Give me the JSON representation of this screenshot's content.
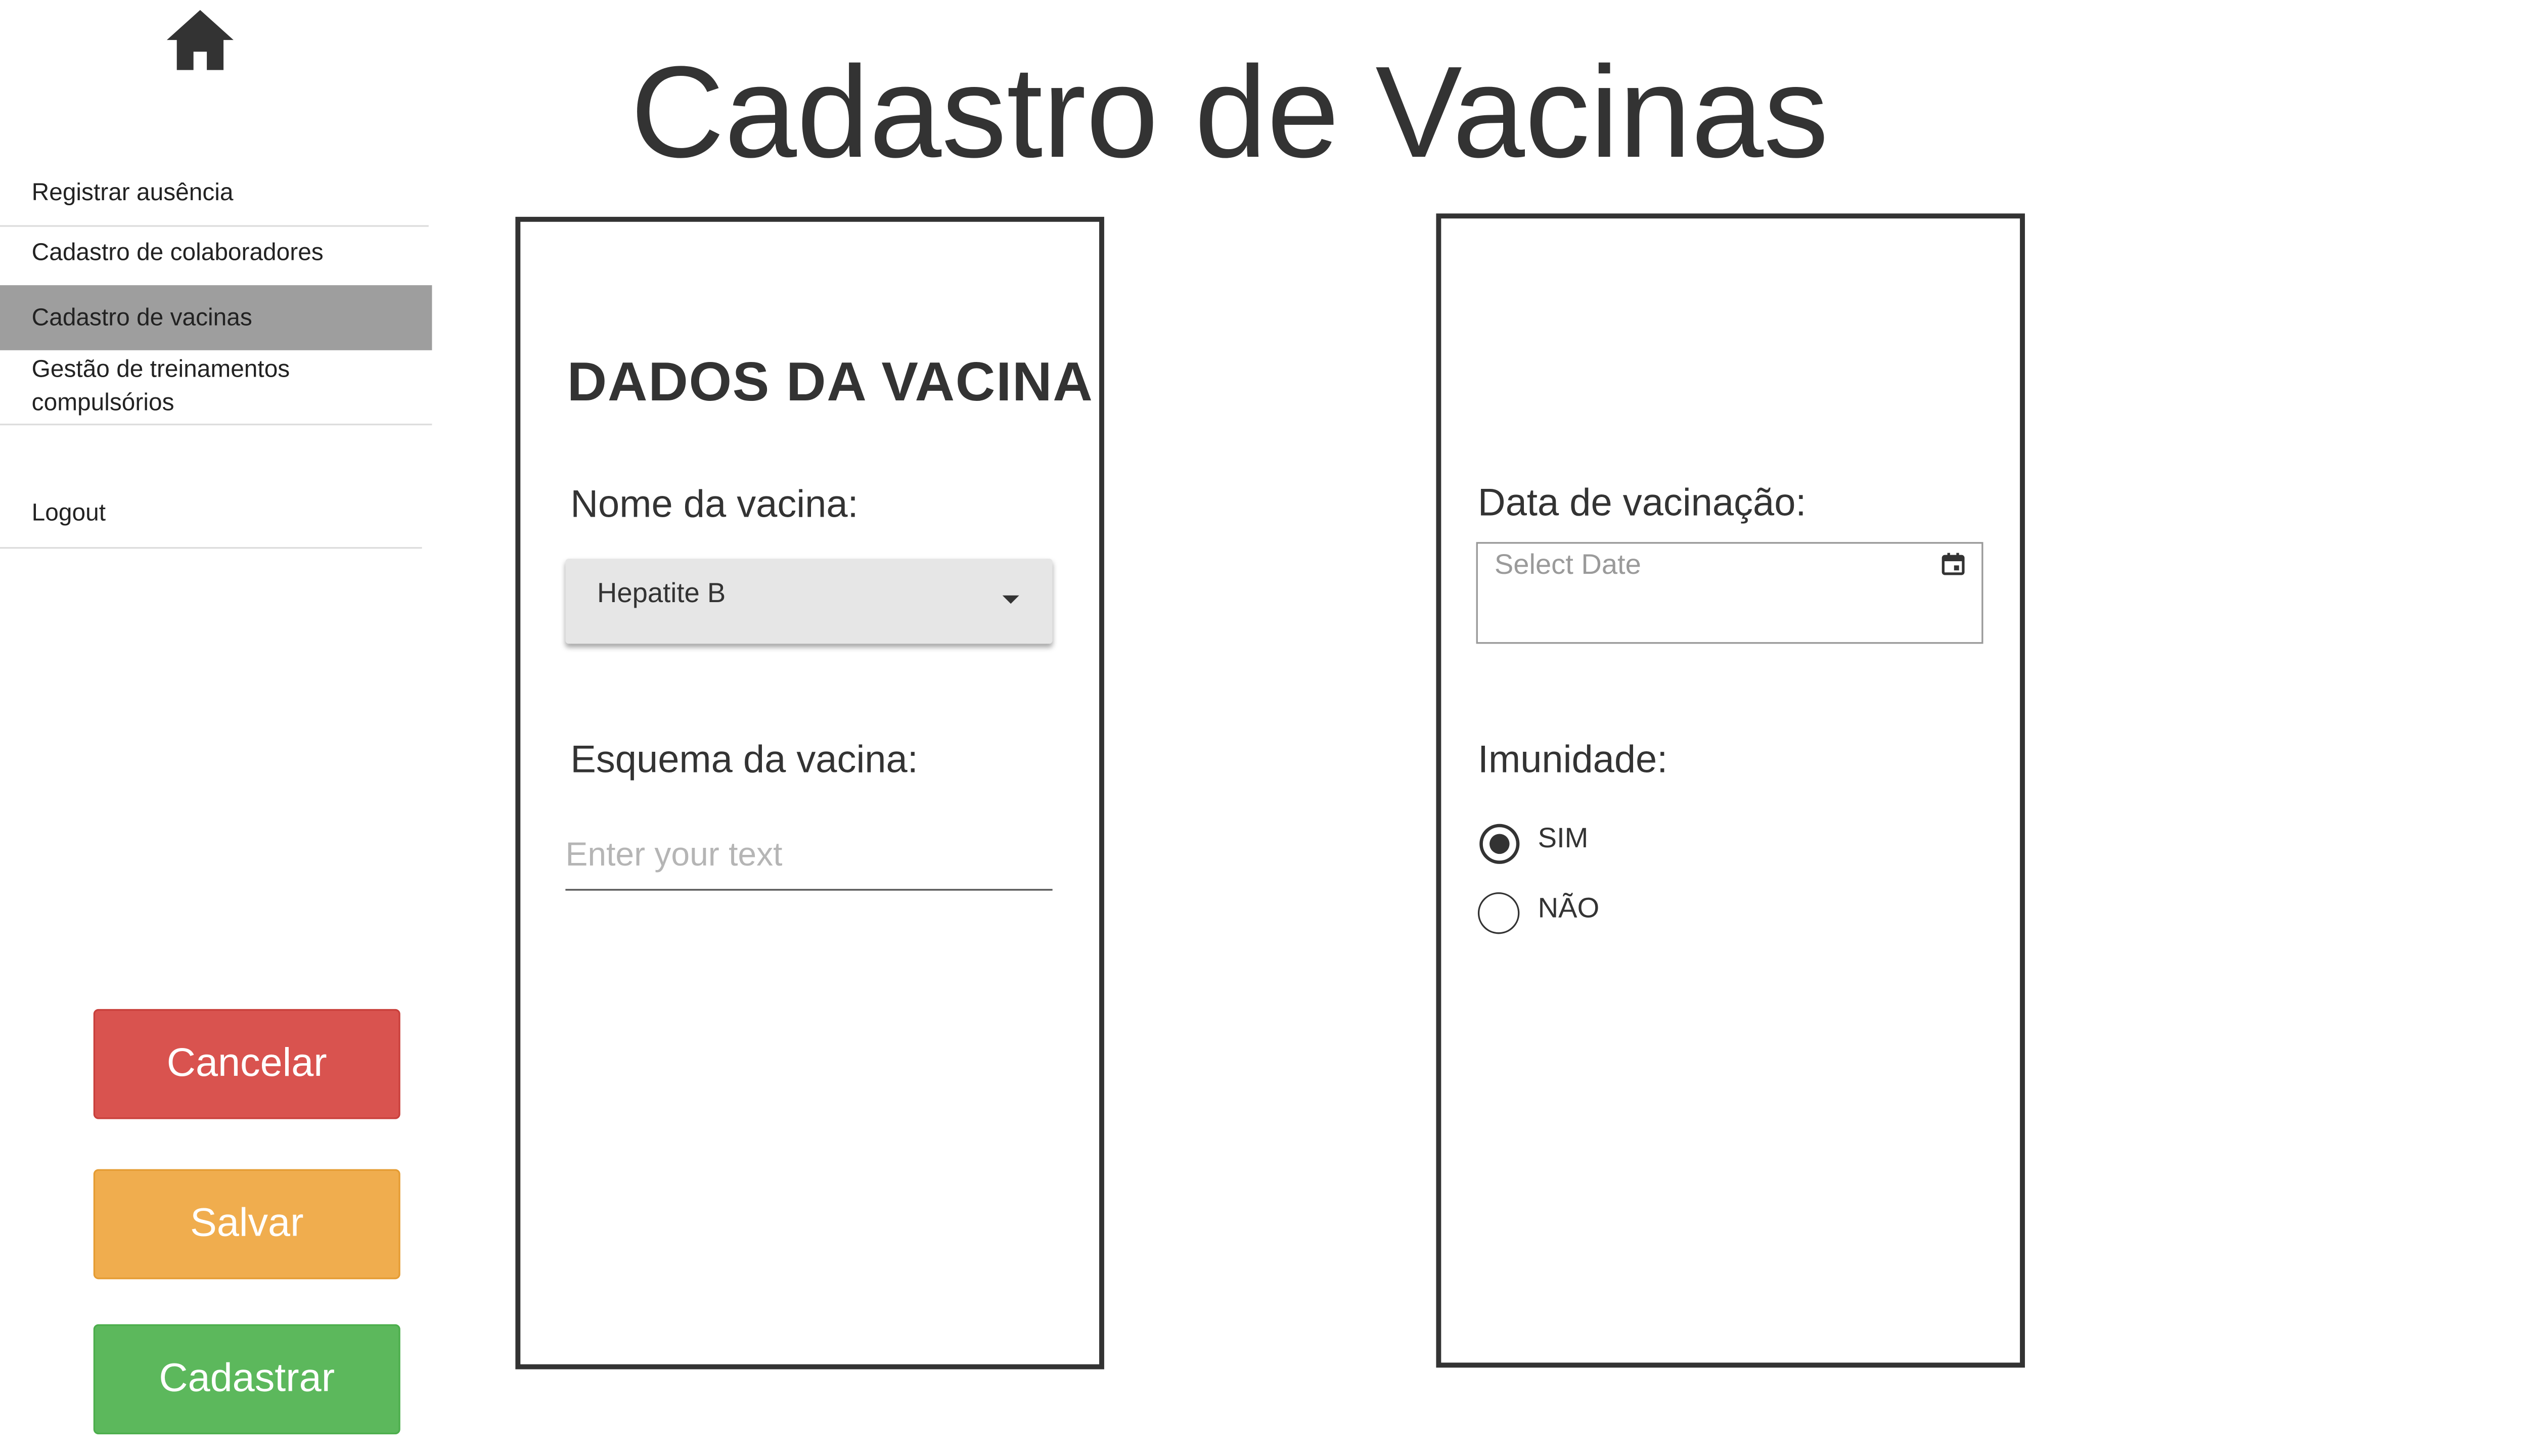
{
  "page": {
    "title": "Cadastro de Vacinas"
  },
  "sidebar": {
    "home_icon": "home-icon",
    "items": [
      {
        "label": "Registrar ausência"
      },
      {
        "label": "Cadastro de colaboradores"
      },
      {
        "label": "Cadastro de vacinas",
        "active": true
      },
      {
        "label": "Gestão de treinamentos compulsórios"
      },
      {
        "label": "Logout"
      }
    ],
    "active_color": "#9e9e9e"
  },
  "actions": {
    "cancel_label": "Cancelar",
    "save_label": "Salvar",
    "register_label": "Cadastrar",
    "cancel_color": "#d9534f",
    "save_color": "#f0ad4e",
    "register_color": "#5cb85c"
  },
  "vaccine_panel": {
    "heading": "DADOS DA VACINA",
    "name_label": "Nome da vacina:",
    "name_value": "Hepatite B",
    "scheme_label": "Esquema da vacina:",
    "scheme_value": "",
    "scheme_placeholder": "Enter your text"
  },
  "vaccination_panel": {
    "date_label": "Data de vacinação:",
    "date_placeholder": "Select Date",
    "date_icon": "calendar-icon",
    "immunity_label": "Imunidade:",
    "options": [
      {
        "label": "SIM",
        "selected": true
      },
      {
        "label": "NÃO",
        "selected": false
      }
    ]
  }
}
